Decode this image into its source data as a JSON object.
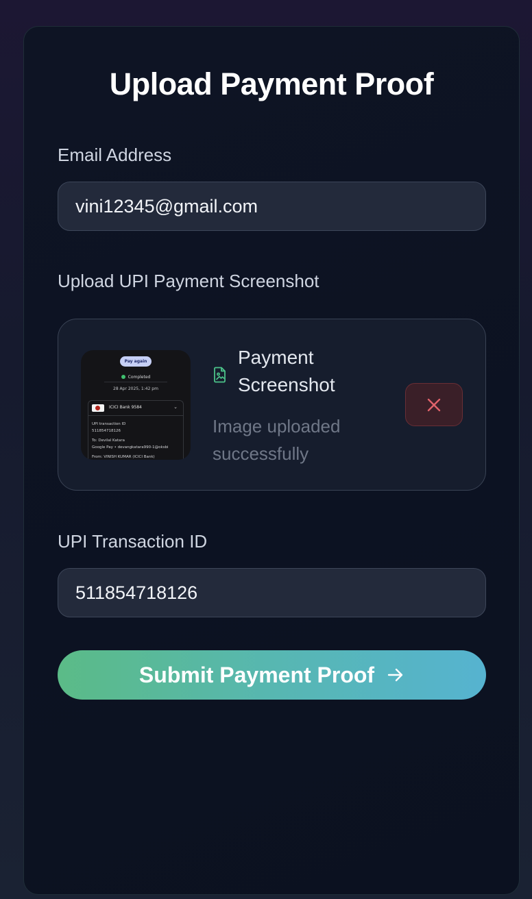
{
  "form": {
    "title": "Upload Payment Proof",
    "email_label": "Email Address",
    "email_value": "vini12345@gmail.com",
    "upload_label": "Upload UPI Payment Screenshot",
    "file_title": "Payment Screenshot",
    "file_status": "Image uploaded successfully",
    "txn_label": "UPI Transaction ID",
    "txn_value": "511854718126",
    "submit_label": "Submit Payment Proof",
    "icons": {
      "file": "image-file-icon",
      "remove": "close-icon",
      "submit": "arrow-right-icon"
    }
  },
  "thumbnail": {
    "pay_again": "Pay again",
    "status": "Completed",
    "date": "28 Apr 2025, 1:42 pm",
    "bank": "ICICI Bank 9584",
    "txn_id_label": "UPI transaction ID",
    "txn_id": "511854718126",
    "to": "To: Devilal Katara",
    "gpay": "Google Pay • devangkatara990-1@oksbi",
    "from": "From: VINISH KUMAR (ICICI Bank)"
  },
  "colors": {
    "accent_green": "#5bbb87",
    "accent_blue": "#56b3d0",
    "danger": "#e0626a",
    "file_icon": "#4cc38a"
  }
}
